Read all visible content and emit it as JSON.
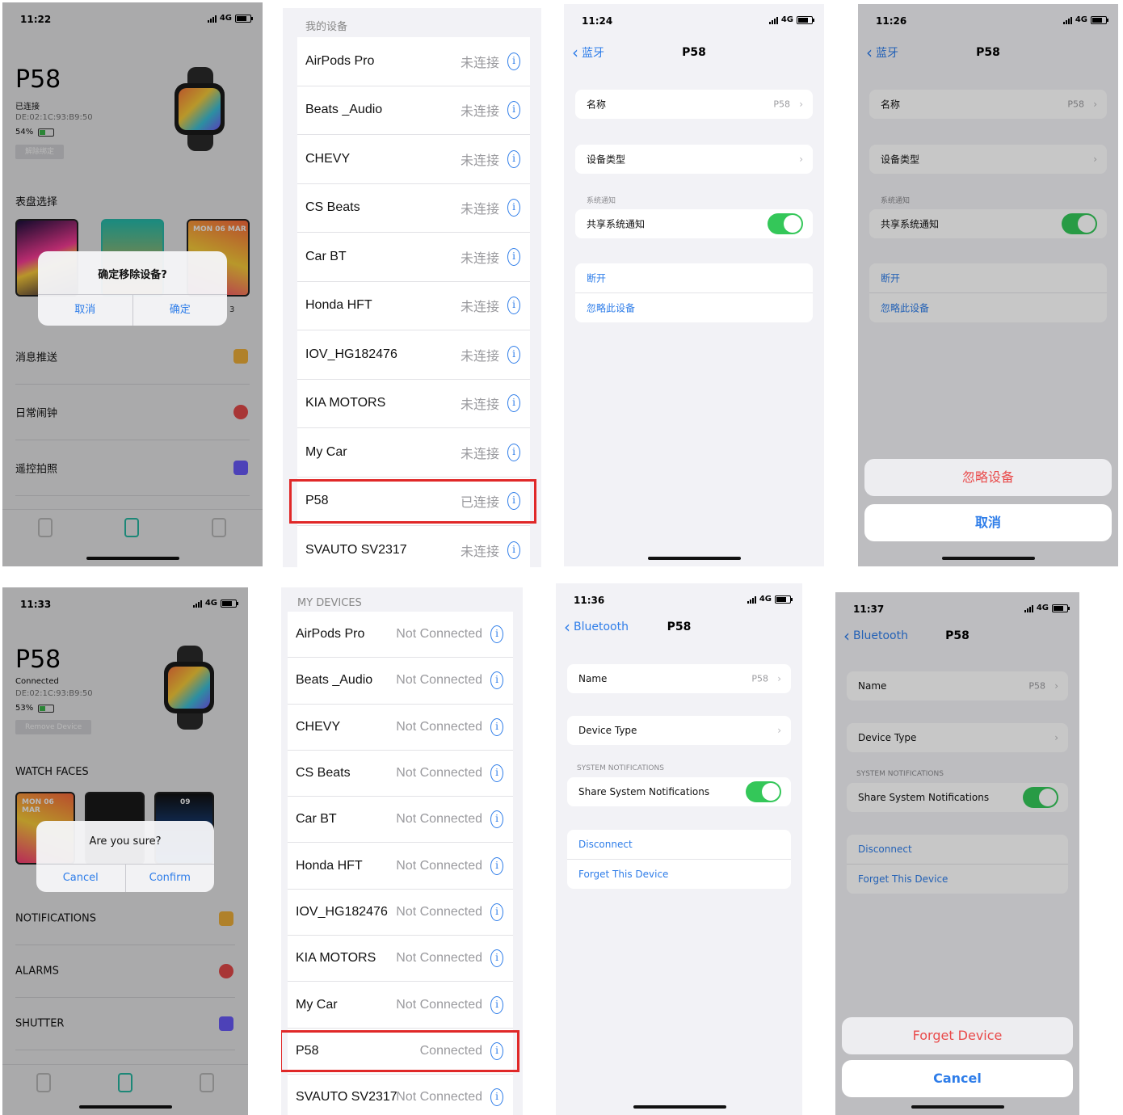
{
  "panels": {
    "p1": {
      "time": "11:22",
      "network": "4G",
      "device_name": "P58",
      "status": "已连接",
      "mac": "DE:02:1C:93:B9:50",
      "battery": "54%",
      "battery_level": 0.54,
      "remove_label": "解除绑定",
      "section_faces": "表盘选择",
      "face3_label": "MON 06 MAR",
      "alert_title": "确定移除设备?",
      "alert_cancel": "取消",
      "alert_confirm": "确定",
      "alert_side": "3",
      "rows": [
        "消息推送",
        "日常闹钟",
        "遥控拍照"
      ]
    },
    "p2": {
      "header": "我的设备",
      "devices": [
        {
          "name": "AirPods Pro",
          "status": "未连接"
        },
        {
          "name": "Beats _Audio",
          "status": "未连接"
        },
        {
          "name": "CHEVY",
          "status": "未连接"
        },
        {
          "name": "CS Beats",
          "status": "未连接"
        },
        {
          "name": "Car BT",
          "status": "未连接"
        },
        {
          "name": "Honda HFT",
          "status": "未连接"
        },
        {
          "name": "IOV_HG182476",
          "status": "未连接"
        },
        {
          "name": "KIA MOTORS",
          "status": "未连接"
        },
        {
          "name": "My Car",
          "status": "未连接"
        },
        {
          "name": "P58",
          "status": "已连接"
        },
        {
          "name": "SVAUTO SV2317",
          "status": "未连接"
        }
      ],
      "info_glyph": "i"
    },
    "p3": {
      "time": "11:24",
      "network": "4G",
      "back": "蓝牙",
      "title": "P58",
      "name_label": "名称",
      "name_value": "P58",
      "device_type": "设备类型",
      "sys_section": "系统通知",
      "share_label": "共享系统通知",
      "share_on": true,
      "disconnect": "断开",
      "forget": "忽略此设备"
    },
    "p4": {
      "time": "11:26",
      "network": "4G",
      "back": "蓝牙",
      "title": "P58",
      "name_label": "名称",
      "name_value": "P58",
      "device_type": "设备类型",
      "sys_section": "系统通知",
      "share_label": "共享系统通知",
      "share_on": true,
      "disconnect": "断开",
      "forget": "忽略此设备",
      "sheet_forget": "忽略设备",
      "sheet_cancel": "取消"
    },
    "p5": {
      "time": "11:33",
      "network": "4G",
      "device_name": "P58",
      "status": "Connected",
      "mac": "DE:02:1C:93:B9:50",
      "battery": "53%",
      "battery_level": 0.53,
      "remove_label": "Remove Device",
      "section_faces": "WATCH FACES",
      "face1_label": "MON 06 MAR",
      "face3_label": "09",
      "alert_title": "Are you sure?",
      "alert_cancel": "Cancel",
      "alert_confirm": "Confirm",
      "rows": [
        "NOTIFICATIONS",
        "ALARMS",
        "SHUTTER"
      ]
    },
    "p6": {
      "header": "MY DEVICES",
      "devices": [
        {
          "name": "AirPods Pro",
          "status": "Not Connected"
        },
        {
          "name": "Beats _Audio",
          "status": "Not Connected"
        },
        {
          "name": "CHEVY",
          "status": "Not Connected"
        },
        {
          "name": "CS Beats",
          "status": "Not Connected"
        },
        {
          "name": "Car BT",
          "status": "Not Connected"
        },
        {
          "name": "Honda HFT",
          "status": "Not Connected"
        },
        {
          "name": "IOV_HG182476",
          "status": "Not Connected"
        },
        {
          "name": "KIA MOTORS",
          "status": "Not Connected"
        },
        {
          "name": "My Car",
          "status": "Not Connected"
        },
        {
          "name": "P58",
          "status": "Connected"
        },
        {
          "name": "SVAUTO SV2317",
          "status": "Not Connected"
        }
      ],
      "info_glyph": "i"
    },
    "p7": {
      "time": "11:36",
      "network": "4G",
      "back": "Bluetooth",
      "title": "P58",
      "name_label": "Name",
      "name_value": "P58",
      "device_type": "Device Type",
      "sys_section": "SYSTEM NOTIFICATIONS",
      "share_label": "Share System Notifications",
      "share_on": true,
      "disconnect": "Disconnect",
      "forget": "Forget This Device"
    },
    "p8": {
      "time": "11:37",
      "network": "4G",
      "back": "Bluetooth",
      "title": "P58",
      "name_label": "Name",
      "name_value": "P58",
      "device_type": "Device Type",
      "sys_section": "SYSTEM NOTIFICATIONS",
      "share_label": "Share System Notifications",
      "share_on": true,
      "disconnect": "Disconnect",
      "forget": "Forget This Device",
      "sheet_forget": "Forget Device",
      "sheet_cancel": "Cancel"
    }
  },
  "colors": {
    "accent": "#2e7de9",
    "toggle_on": "#34c759",
    "highlight": "#e02828",
    "tab_active": "#27bca6",
    "destructive": "#e94b4b"
  },
  "chevron": "›",
  "back_chevron": "‹"
}
